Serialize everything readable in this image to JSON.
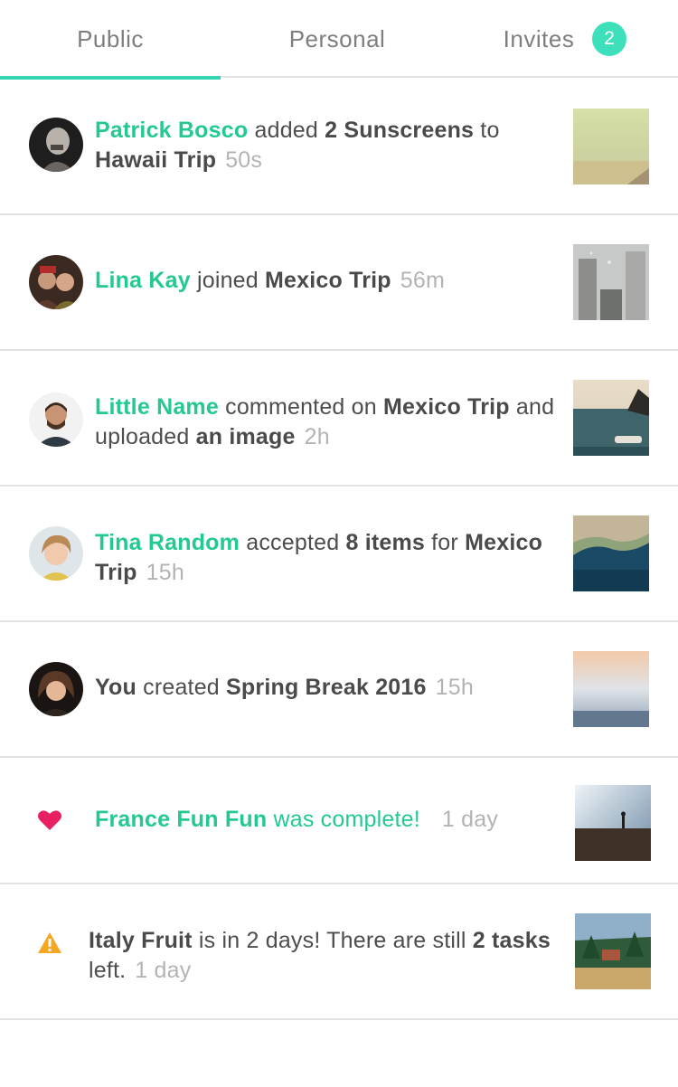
{
  "tabs": {
    "public": "Public",
    "personal": "Personal",
    "invites": "Invites",
    "invites_badge": "2"
  },
  "feed": [
    {
      "name": "Patrick Bosco",
      "text1": " added ",
      "bold1": "2 Sunscreens",
      "text2": " to ",
      "bold2": "Hawaii Trip",
      "time": "50s"
    },
    {
      "name": "Lina Kay",
      "text1": " joined ",
      "bold1": "Mexico Trip",
      "time": "56m"
    },
    {
      "name": "Little Name",
      "text1": " commented on ",
      "bold1": "Mexico Trip",
      "text2": " and uploaded ",
      "bold2": "an image",
      "time": "2h"
    },
    {
      "name": "Tina Random",
      "text1": " accepted ",
      "bold1": "8 items",
      "text2": " for ",
      "bold2": "Mexico Trip",
      "time": "15h"
    },
    {
      "bold0": "You",
      "text1": " created ",
      "bold1": "Spring Break 2016",
      "time": "15h"
    },
    {
      "name": "France Fun Fun",
      "text1": " was complete!",
      "time": "1 day",
      "icon": "heart-icon",
      "color": "#e8205f"
    },
    {
      "bold0": "Italy Fruit",
      "text1": " is in 2 days! There are still ",
      "bold1": "2",
      "text2": " ",
      "bold2": "tasks",
      "text3": " left.",
      "time": "1 day",
      "icon": "warning-icon",
      "color": "#f5a623"
    }
  ],
  "colors": {
    "accent": "#24c98f",
    "badge": "#3ee0bb",
    "heart": "#e8205f",
    "warning": "#f5a623"
  }
}
